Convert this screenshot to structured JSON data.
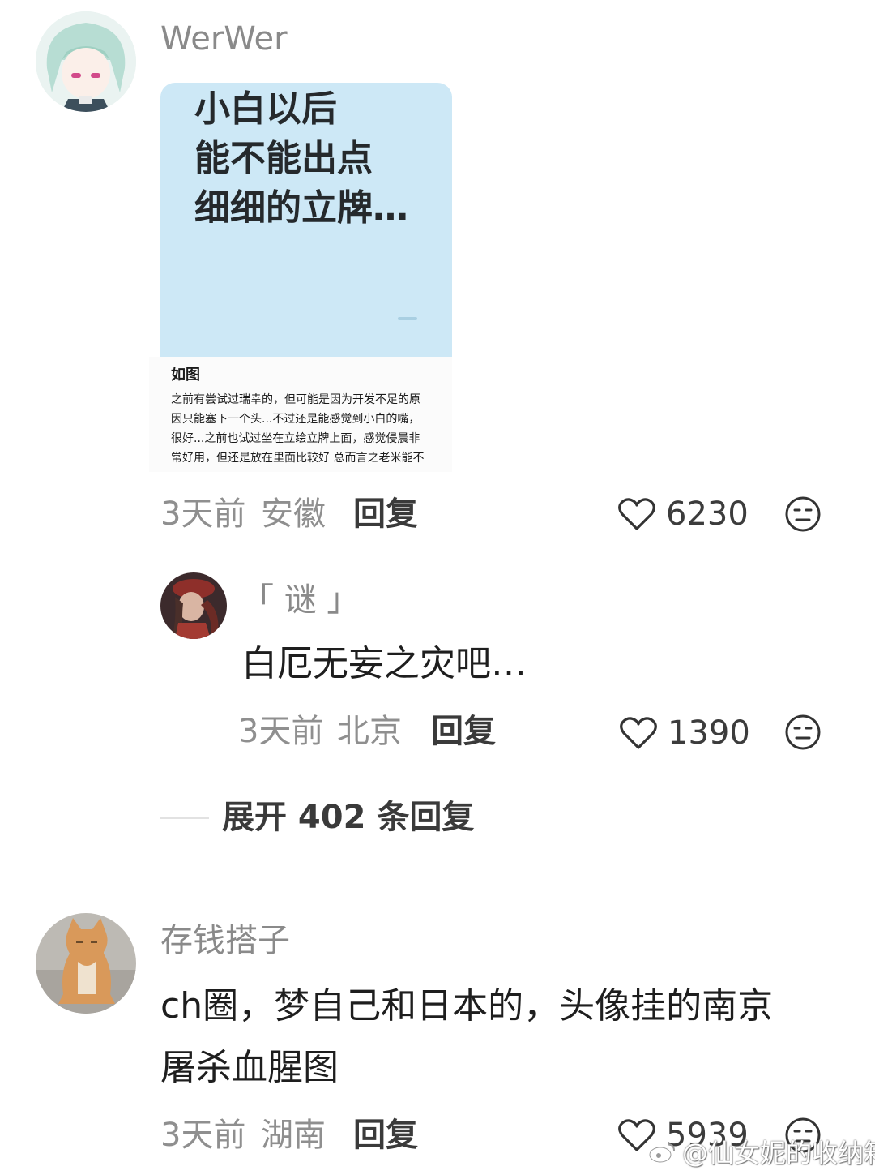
{
  "comments": [
    {
      "user": "WerWer",
      "card": {
        "title_lines": [
          "小白以后",
          "能不能出点",
          "细细的立牌…"
        ],
        "quote_heading": "如图",
        "quote_lines": [
          "之前有尝试过瑞幸的，但可能是因为开发不足的原",
          "因只能塞下一个头...不过还是能感觉到小白的嘴，",
          "很好...之前也试过坐在立绘立牌上面，感觉侵晨非",
          "常好用，但还是放在里面比较好 总而言之老米能不"
        ]
      },
      "time": "3天前",
      "location": "安徽",
      "reply_label": "回复",
      "likes": "6230"
    },
    {
      "user": "存钱搭子",
      "text_lines": [
        "ch圈，梦自己和日本的，头像挂的南京",
        "屠杀血腥图"
      ],
      "time": "3天前",
      "location": "湖南",
      "reply_label": "回复",
      "likes": "5939"
    }
  ],
  "sub_reply": {
    "user": "「 谜 」",
    "text": "白厄无妄之灾吧…",
    "time": "3天前",
    "location": "北京",
    "reply_label": "回复",
    "likes": "1390"
  },
  "expand_replies": "展开 402 条回复",
  "watermark": "@仙女妮的收纳箱",
  "icons": {
    "like": "heart-outline-icon",
    "dislike": "neutral-face-icon",
    "watermark_logo": "weibo-logo-icon"
  }
}
